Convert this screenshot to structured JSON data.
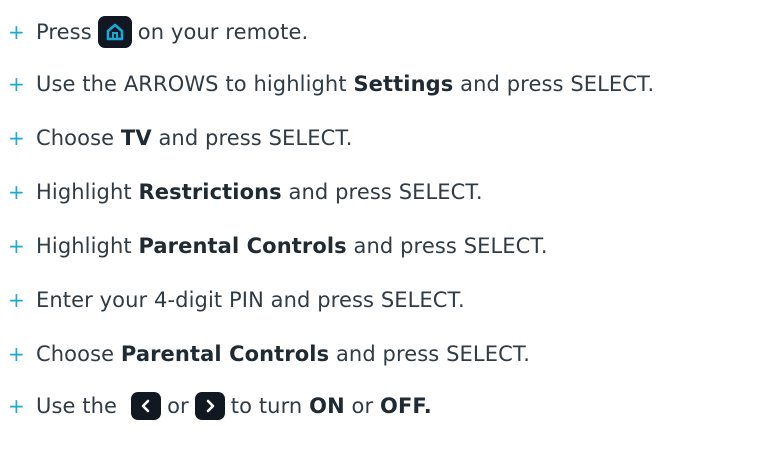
{
  "bullet_symbol": "+",
  "colors": {
    "bullet": "#1aa9d6",
    "text": "#2f3b45",
    "icon_background": "#111821",
    "home_icon_stroke": "#1aa9d6",
    "arrow_icon_stroke": "#ffffff"
  },
  "icons": {
    "home": "home-icon",
    "left": "chevron-left-icon",
    "right": "chevron-right-icon"
  },
  "steps": [
    {
      "before": "Press",
      "after": "on your remote."
    },
    {
      "before": "Use the ARROWS to highlight ",
      "bold": "Settings",
      "after": " and press SELECT."
    },
    {
      "before": "Choose ",
      "bold": "TV",
      "after": " and press SELECT."
    },
    {
      "before": "Highlight ",
      "bold": "Restrictions",
      "after": " and press SELECT."
    },
    {
      "before": "Highlight ",
      "bold": "Parental Controls",
      "after": " and press SELECT."
    },
    {
      "before": "Enter your 4-digit PIN and press SELECT."
    },
    {
      "before": "Choose ",
      "bold": "Parental Controls",
      "after": " and press SELECT."
    },
    {
      "before": "Use the",
      "middle": "or",
      "after": "to turn ",
      "bold1": "ON",
      "sep": " or ",
      "bold2": "OFF."
    }
  ]
}
